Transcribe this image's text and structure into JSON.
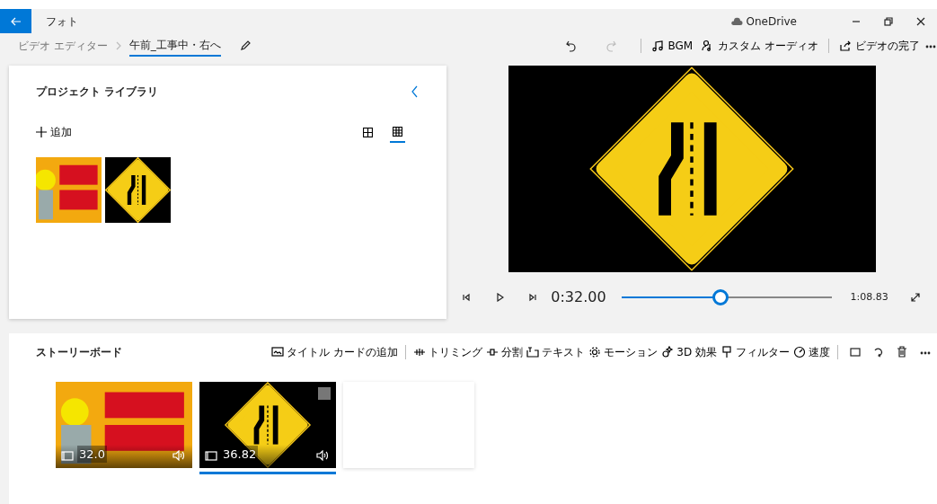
{
  "window": {
    "title": "フォト",
    "cloud": "OneDrive"
  },
  "breadcrumb": [
    {
      "label": "ビデオ エディター",
      "selected": false
    },
    {
      "label": "午前_工事中・右へ",
      "selected": true
    }
  ],
  "toolbar": [
    {
      "kind": "music",
      "label": "BGM"
    },
    {
      "kind": "audio",
      "label": "カスタム オーディオ"
    },
    {
      "kind": "share",
      "label": "ビデオの完了"
    }
  ],
  "library": {
    "title": "プロジェクト ライブラリ",
    "add": "追加",
    "views": [
      {
        "kind": "large",
        "selected": false
      },
      {
        "kind": "small",
        "selected": true
      }
    ],
    "items": [
      {
        "kind": "sign-board"
      },
      {
        "kind": "road-sign"
      }
    ]
  },
  "player": {
    "current": "0:32.00",
    "total": "1:08.83",
    "level": 0.47
  },
  "storyboard": {
    "title": "ストーリーボード",
    "actions": [
      {
        "kind": "title-card",
        "label": "タイトル カードの追加"
      },
      {
        "kind": "trim",
        "label": "トリミング"
      },
      {
        "kind": "split",
        "label": "分割"
      },
      {
        "kind": "text",
        "label": "テキスト"
      },
      {
        "kind": "motion",
        "label": "モーション"
      },
      {
        "kind": "effects",
        "label": "3D 効果"
      },
      {
        "kind": "filter",
        "label": "フィルター"
      },
      {
        "kind": "speed",
        "label": "速度"
      }
    ],
    "clips": [
      {
        "kind": "sign-board",
        "duration": "32.0",
        "selected": false
      },
      {
        "kind": "road-sign",
        "duration": "36.82",
        "selected": true
      }
    ]
  }
}
